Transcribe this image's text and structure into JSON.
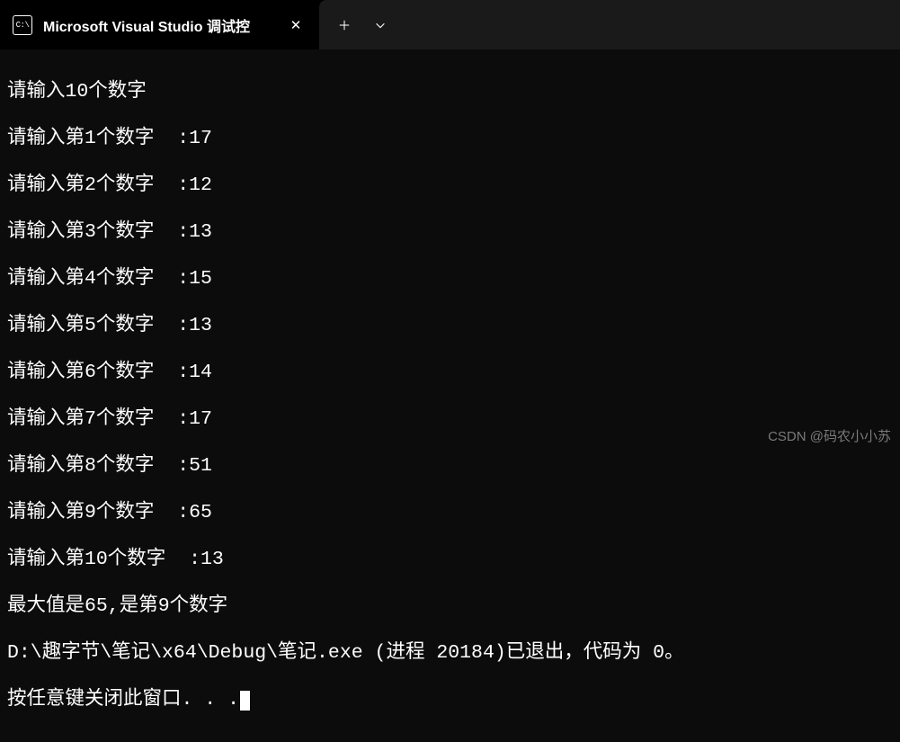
{
  "titlebar": {
    "tab_icon_text": "C:\\",
    "tab_title": "Microsoft Visual Studio 调试控",
    "close_label": "✕"
  },
  "terminal": {
    "lines": [
      "请输入10个数字",
      "请输入第1个数字  :17",
      "请输入第2个数字  :12",
      "请输入第3个数字  :13",
      "请输入第4个数字  :15",
      "请输入第5个数字  :13",
      "请输入第6个数字  :14",
      "请输入第7个数字  :17",
      "请输入第8个数字  :51",
      "请输入第9个数字  :65",
      "请输入第10个数字  :13",
      "最大值是65,是第9个数字",
      "D:\\趣字节\\笔记\\x64\\Debug\\笔记.exe (进程 20184)已退出，代码为 0。"
    ],
    "last_line": "按任意键关闭此窗口. . ."
  },
  "watermark": "CSDN @码农小小苏"
}
